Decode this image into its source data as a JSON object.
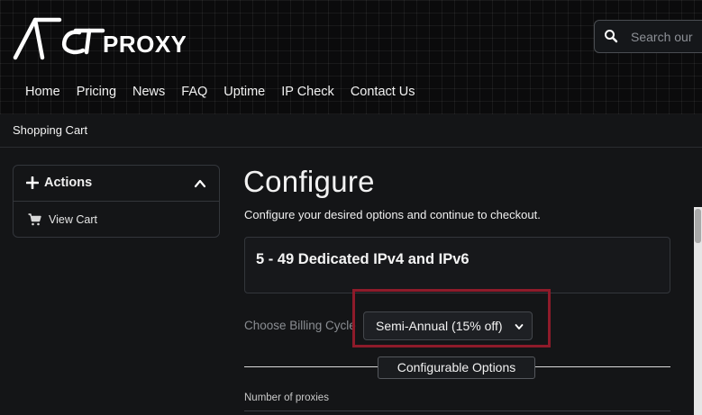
{
  "brand": {
    "logo_text": "ACTPROXY"
  },
  "search": {
    "placeholder": "Search our",
    "icon": "search-icon"
  },
  "nav": {
    "items": [
      "Home",
      "Pricing",
      "News",
      "FAQ",
      "Uptime",
      "IP Check",
      "Contact Us"
    ]
  },
  "breadcrumb": {
    "label": "Shopping Cart"
  },
  "sidebar": {
    "title": "Actions",
    "title_icon": "plus-icon",
    "collapse_icon": "chevron-up-icon",
    "links": [
      {
        "label": "View Cart",
        "icon": "cart-icon"
      }
    ]
  },
  "main": {
    "title": "Configure",
    "subtitle": "Configure your desired options and continue to checkout.",
    "product_name": "5 - 49 Dedicated IPv4 and IPv6",
    "billing": {
      "label": "Choose Billing Cycle",
      "selected": "Semi-Annual (15% off)"
    },
    "section_title": "Configurable Options",
    "fields": [
      {
        "label": "Number of proxies"
      }
    ]
  },
  "colors": {
    "background": "#141517",
    "highlight_border": "#8e1b2a",
    "card_border": "#33363b"
  }
}
